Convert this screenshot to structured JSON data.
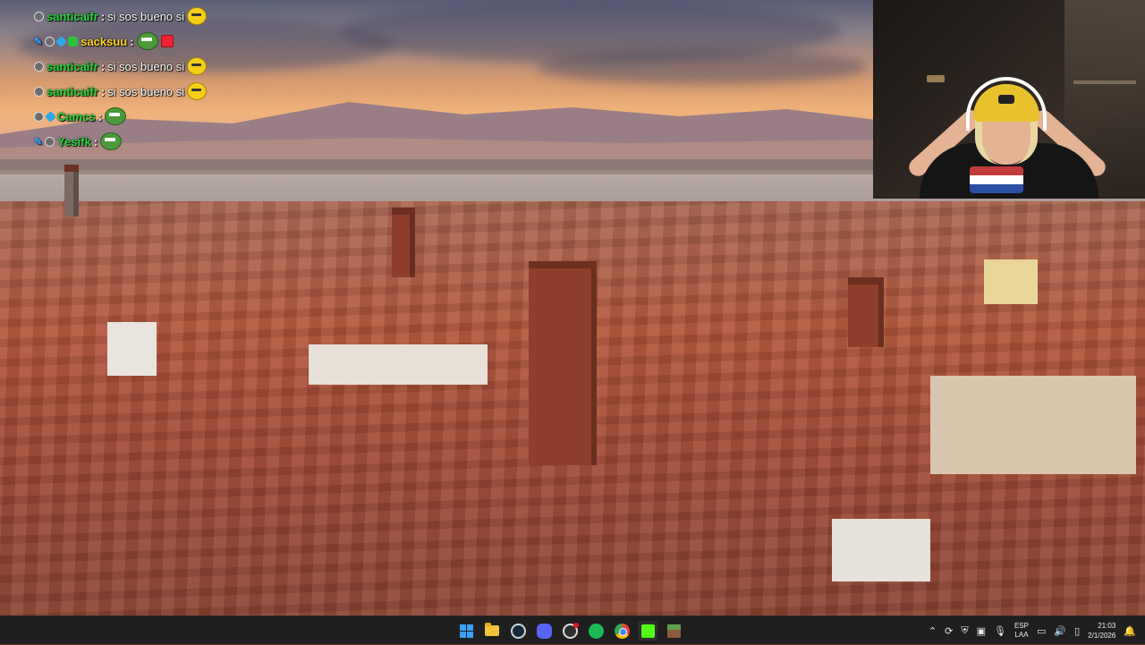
{
  "chat": {
    "messages": [
      {
        "user": "santicaifr",
        "text": "si sos bueno si",
        "user_color": "#2bd63f"
      },
      {
        "user": "sacksuu",
        "text": "",
        "user_color": "#ffd21f"
      },
      {
        "user": "santicaifr",
        "text": "si sos bueno si",
        "user_color": "#2bd63f"
      },
      {
        "user": "santicaifr",
        "text": "si sos bueno si",
        "user_color": "#2bd63f"
      },
      {
        "user": "Camcs",
        "text": "",
        "user_color": "#2bd63f"
      },
      {
        "user": "Yesifk",
        "text": "",
        "user_color": "#2bd63f"
      }
    ]
  },
  "taskbar": {
    "pinned": [
      "start-icon",
      "file-explorer-icon",
      "steam-icon",
      "discord-icon",
      "obs-icon",
      "spotify-icon",
      "chrome-icon",
      "kick-icon",
      "minecraft-icon"
    ],
    "tray": {
      "language": "ESP",
      "layout": "LAA",
      "time": "21:03",
      "date": "2/1/2026"
    }
  },
  "colors": {
    "taskbar_bg": "#1f1f1f",
    "chat_user_green": "#2bd63f",
    "windows_blue": "#3aa0ff"
  }
}
